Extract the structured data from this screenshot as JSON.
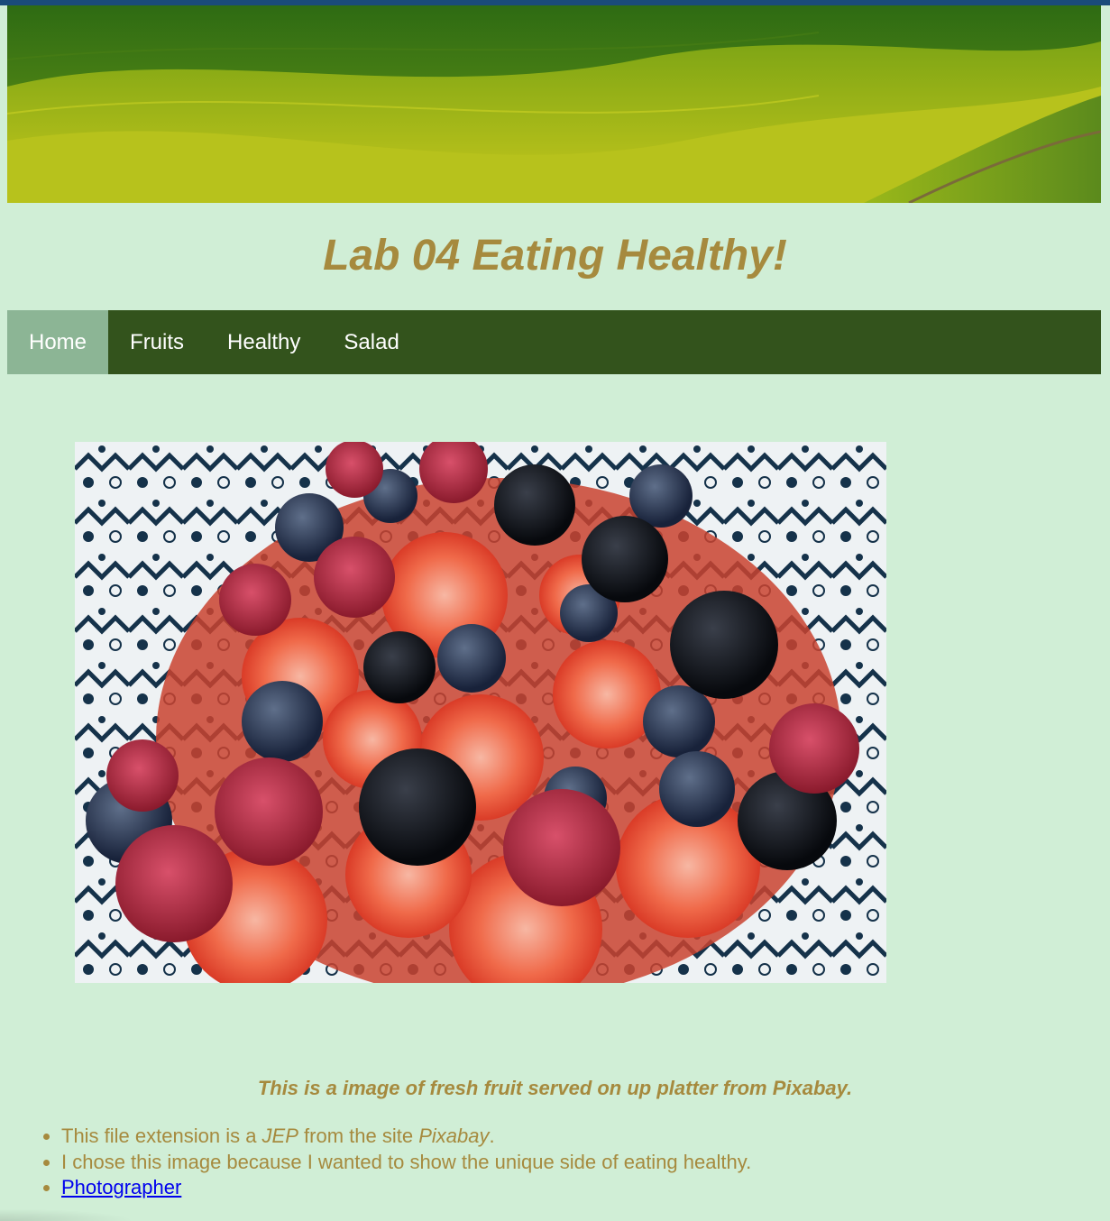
{
  "header": {
    "title": "Lab 04 Eating Healthy!"
  },
  "nav": {
    "items": [
      {
        "label": "Home",
        "active": true
      },
      {
        "label": "Fruits",
        "active": false
      },
      {
        "label": "Healthy",
        "active": false
      },
      {
        "label": "Salad",
        "active": false
      }
    ]
  },
  "main": {
    "caption": "This is a image of fresh fruit served on up platter from Pixabay.",
    "list": {
      "item1_prefix": "This file extension is a ",
      "item1_em1": "JEP",
      "item1_middle": " from the site ",
      "item1_em2": "Pixabay",
      "item1_suffix": ".",
      "item2": "I chose this image because I wanted to show the unique side of eating healthy.",
      "item3_link": "Photographer"
    }
  },
  "colors": {
    "background": "#d0eed6",
    "heading": "#a68a3e",
    "nav_bg": "#33531c",
    "nav_active": "#8cb595",
    "link": "#0000ee"
  }
}
